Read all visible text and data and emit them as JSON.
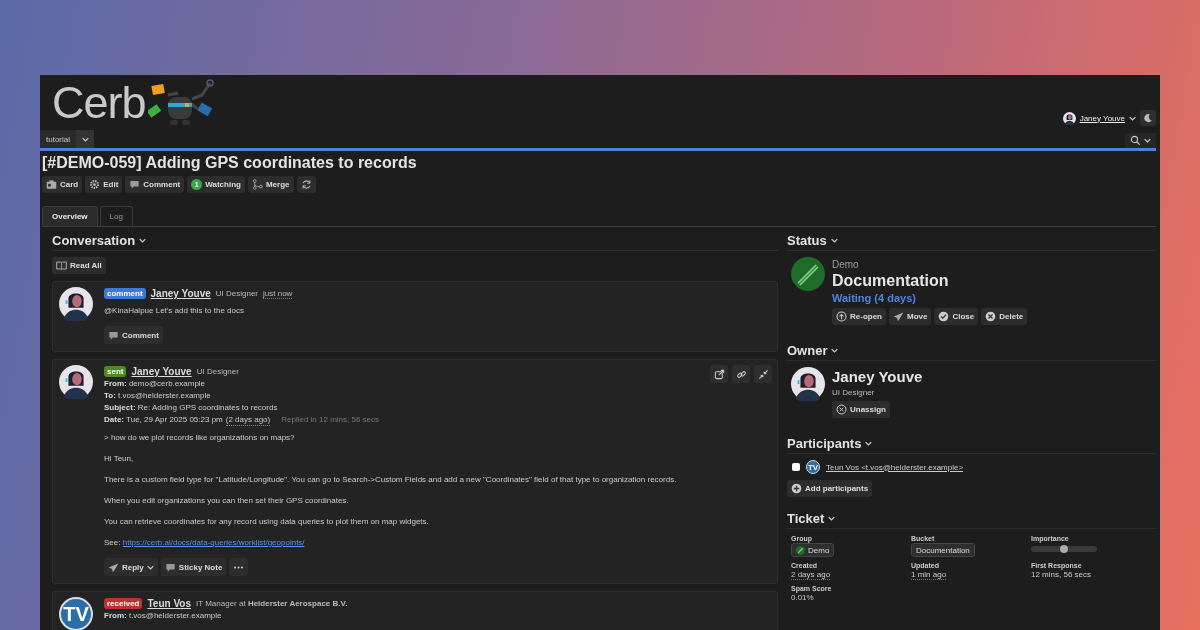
{
  "header": {
    "logo": "Cerb",
    "user": "Janey Youve"
  },
  "workspace": {
    "label": "tutorial"
  },
  "ticket": {
    "title": "[#DEMO-059] Adding GPS coordinates to records"
  },
  "toolbar": [
    {
      "kind": "card",
      "label": "Card"
    },
    {
      "kind": "edit",
      "label": "Edit"
    },
    {
      "kind": "comment",
      "label": "Comment"
    },
    {
      "kind": "watch",
      "label": "Watching",
      "count": "1"
    },
    {
      "kind": "merge",
      "label": "Merge"
    },
    {
      "kind": "refresh"
    }
  ],
  "tabs": [
    {
      "label": "Overview",
      "selected": true
    },
    {
      "label": "Log",
      "selected": false
    }
  ],
  "conversation": {
    "title": "Conversation",
    "read_all": "Read All",
    "messages": [
      {
        "kind": "comment",
        "badge": "comment",
        "author": "Janey Youve",
        "role": "UI Designer",
        "time": "just now",
        "body": [
          {
            "kind": "text",
            "text": "@KinaHalpue Let's add this to the docs"
          }
        ],
        "actions": [
          {
            "kind": "comment",
            "label": "Comment"
          }
        ]
      },
      {
        "kind": "sent",
        "badge": "sent",
        "author": "Janey Youve",
        "role": "UI Designer",
        "tools": [
          {
            "kind": "popout"
          },
          {
            "kind": "link"
          },
          {
            "kind": "collapse"
          }
        ],
        "headers": [
          {
            "label": "From:",
            "value": "demo@cerb.example"
          },
          {
            "label": "To:",
            "value": "t.vos@helderster.example"
          },
          {
            "label": "Subject:",
            "value": "Re: Adding GPS coordinates to records"
          },
          {
            "label": "Date:",
            "value": "Tue, 29 Apr 2025 05:23 pm",
            "note": "(2 days ago)",
            "extra": "Replied in 12 mins, 56 secs"
          }
        ],
        "body": [
          {
            "kind": "text",
            "text": "> how do we plot records like organizations on maps?"
          },
          {
            "kind": "text",
            "text": "Hi Teun,"
          },
          {
            "kind": "text",
            "text": "There is a custom field type for \"Latitude/Longitude\". You can go to Search->Custom Fields and add a new \"Coordinates\" field of that type to organization records."
          },
          {
            "kind": "text",
            "text": "When you edit organizations you can then set their GPS coordinates."
          },
          {
            "kind": "text",
            "text": "You can retrieve coordinates for any record using data queries to plot them on map widgets."
          },
          {
            "kind": "link",
            "label": "See:",
            "url": "https://cerb.ai/docs/data-queries/worklist/geopoints/"
          }
        ],
        "actions": [
          {
            "kind": "reply",
            "label": "Reply"
          },
          {
            "kind": "note",
            "label": "Sticky Note"
          },
          {
            "kind": "more"
          }
        ]
      },
      {
        "kind": "received",
        "badge": "received",
        "initials": "TV",
        "author": "Teun Vos",
        "role": "IT Manager at **Helderster Aerospace B.V.**",
        "headers": [
          {
            "label": "From:",
            "value": "t.vos@helderster.example"
          }
        ]
      }
    ]
  },
  "status": {
    "title": "Status",
    "group": "Demo",
    "bucket": "Documentation",
    "state": "Waiting (4 days)",
    "actions": [
      {
        "kind": "reopen",
        "label": "Re-open"
      },
      {
        "kind": "move",
        "label": "Move"
      },
      {
        "kind": "close",
        "label": "Close"
      },
      {
        "kind": "delete",
        "label": "Delete"
      }
    ]
  },
  "owner": {
    "title": "Owner",
    "name": "Janey Youve",
    "role": "UI Designer",
    "action": "Unassign"
  },
  "participants": {
    "title": "Participants",
    "items": [
      {
        "label": "Teun Vos <t.vos@helderster.example>",
        "initials": "TV",
        "checked": false
      }
    ],
    "add": "Add participants"
  },
  "ticket_fields": {
    "title": "Ticket",
    "fields": [
      {
        "kind": "group",
        "label": "Group",
        "value": "Demo"
      },
      {
        "kind": "chip",
        "label": "Bucket",
        "value": "Documentation"
      },
      {
        "kind": "slider",
        "label": "Importance",
        "level": 0.5
      },
      {
        "kind": "time",
        "label": "Created",
        "value": "2 days ago"
      },
      {
        "kind": "time",
        "label": "Updated",
        "value": "1 min ago"
      },
      {
        "kind": "text",
        "label": "First Response",
        "value": "12 mins, 56 secs"
      },
      {
        "kind": "text",
        "label": "Spam Score",
        "value": "0.01%"
      }
    ]
  }
}
